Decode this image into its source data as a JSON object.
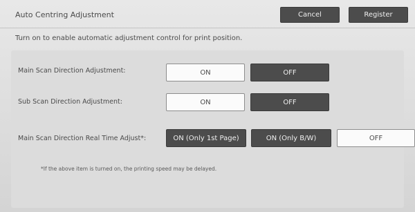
{
  "header": {
    "title": "Auto Centring Adjustment",
    "cancel_label": "Cancel",
    "register_label": "Register"
  },
  "description": "Turn on to enable automatic adjustment control for print position.",
  "settings": [
    {
      "label": "Main Scan Direction Adjustment:",
      "options": [
        {
          "label": "ON",
          "selected": false
        },
        {
          "label": "OFF",
          "selected": true
        }
      ]
    },
    {
      "label": "Sub Scan Direction Adjustment:",
      "options": [
        {
          "label": "ON",
          "selected": false
        },
        {
          "label": "OFF",
          "selected": true
        }
      ]
    },
    {
      "label": "Main Scan Direction Real Time Adjust*:",
      "options": [
        {
          "label": "ON (Only 1st Page)",
          "selected": true
        },
        {
          "label": "ON (Only B/W)",
          "selected": true
        },
        {
          "label": "OFF",
          "selected": false
        }
      ]
    }
  ],
  "note": "*If the above item is turned on, the printing speed may be delayed."
}
